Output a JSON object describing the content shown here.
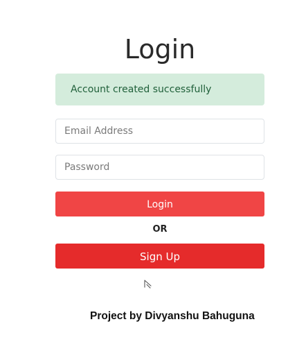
{
  "page": {
    "title": "Login"
  },
  "alert": {
    "message": "Account created successfully",
    "bg_color": "#d4ecdc",
    "text_color": "#20603a"
  },
  "form": {
    "email_placeholder": "Email Address",
    "email_value": "",
    "password_placeholder": "Password",
    "password_value": "",
    "login_label": "Login",
    "or_label": "OR",
    "signup_label": "Sign Up",
    "login_color": "#f04545",
    "signup_color": "#e52b2b"
  },
  "footer": {
    "credit": "Project by Divyanshu Bahuguna"
  },
  "icons": {
    "cursor": "mouse-pointer-icon"
  }
}
